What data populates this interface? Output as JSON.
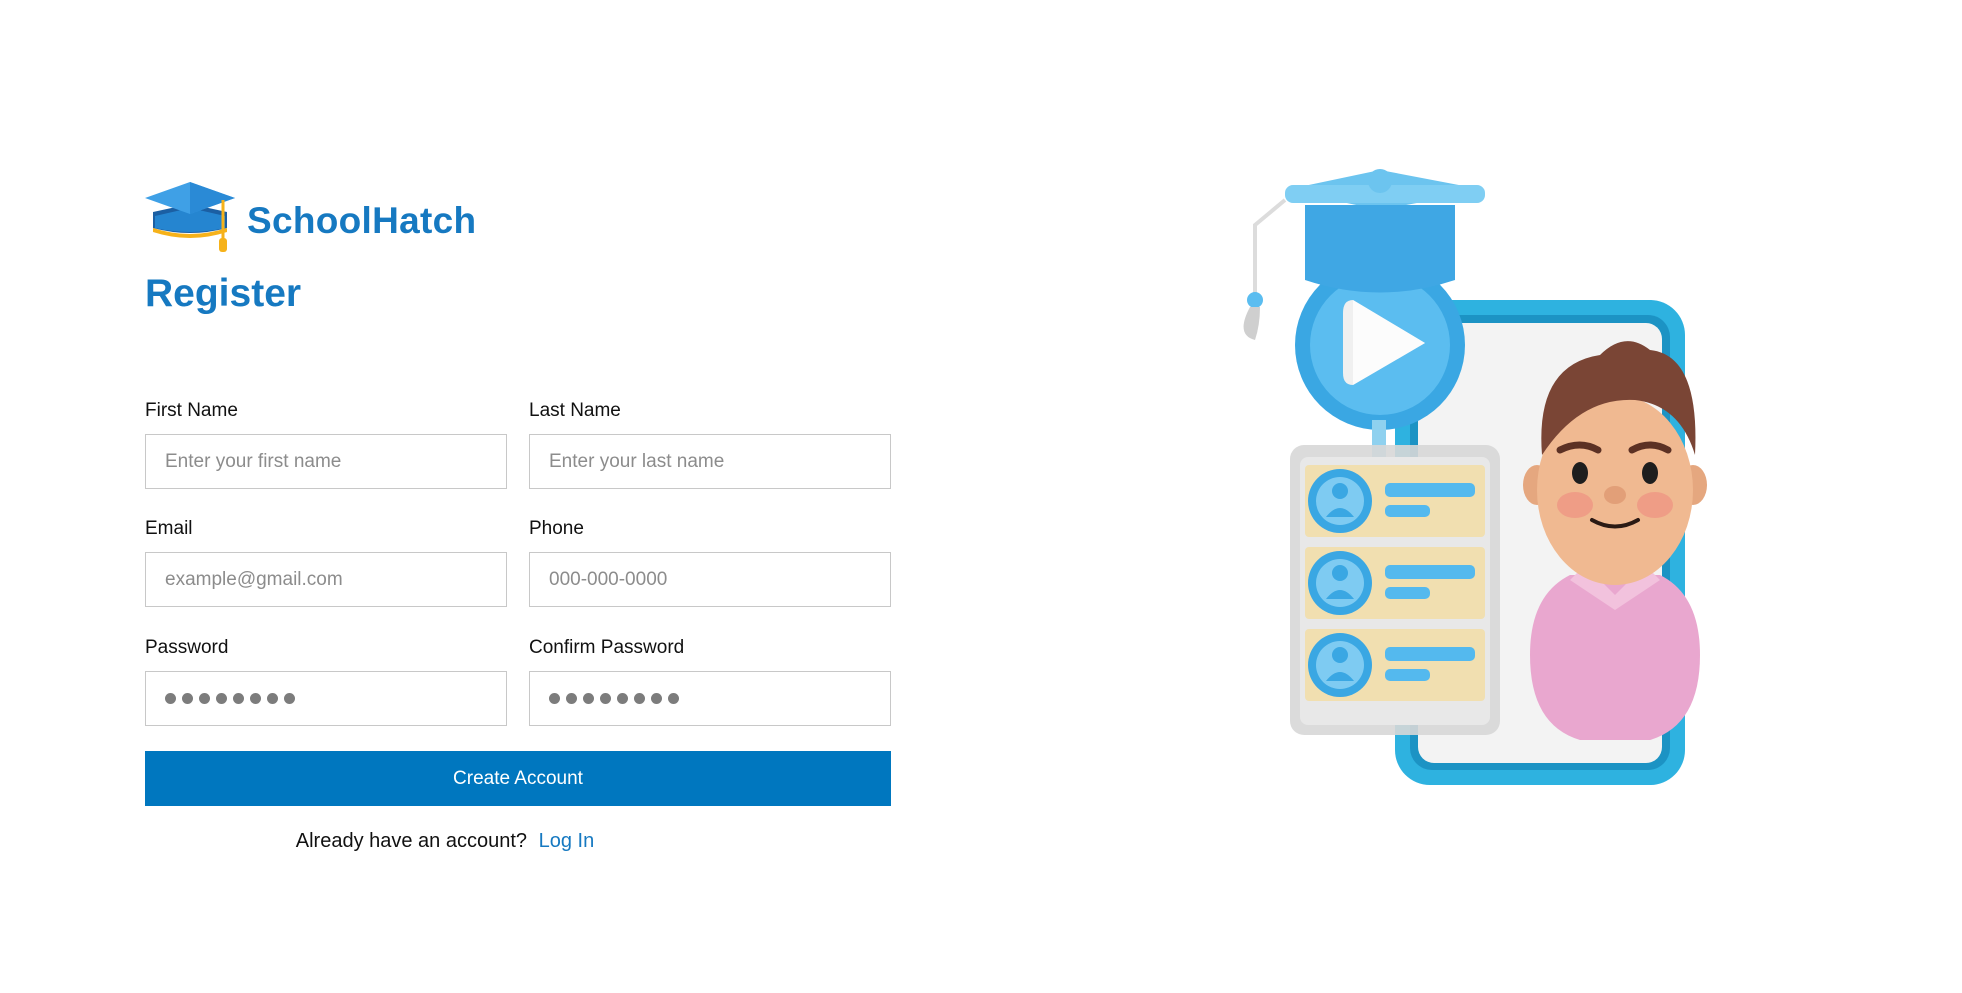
{
  "brand": {
    "name": "SchoolHatch",
    "logo_icon": "graduation-cap-icon",
    "color": "#1679c1"
  },
  "page": {
    "title": "Register"
  },
  "form": {
    "first_name": {
      "label": "First Name",
      "placeholder": "Enter your first name"
    },
    "last_name": {
      "label": "Last Name",
      "placeholder": "Enter your last name"
    },
    "email": {
      "label": "Email",
      "placeholder": "example@gmail.com"
    },
    "phone": {
      "label": "Phone",
      "placeholder": "000-000-0000"
    },
    "password": {
      "label": "Password",
      "masked_length": 8
    },
    "confirm_password": {
      "label": "Confirm Password",
      "masked_length": 8
    },
    "submit_label": "Create Account",
    "submit_color": "#0077bf"
  },
  "signin": {
    "prompt": "Already have an account?",
    "link_label": "Log In"
  },
  "illustration": {
    "icon": "e-learning-illustration"
  }
}
